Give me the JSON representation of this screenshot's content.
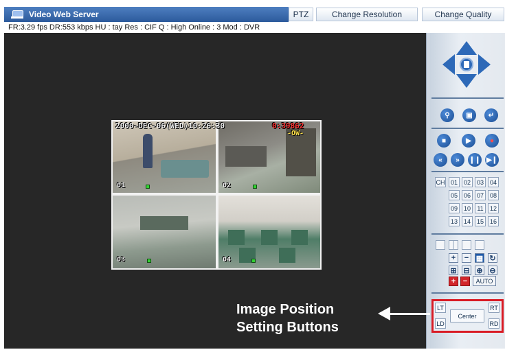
{
  "titlebar": {
    "title": "Video Web Server",
    "logo_icon": "monitor-icon"
  },
  "toolbar": {
    "ptz_label": "PTZ",
    "resolution_label": "Change Resolution",
    "quality_label": "Change Quality"
  },
  "status": {
    "text": "FR:3.29 fps  DR:553 kbps  HU : tay  Res : CIF  Q : High  Online : 3  Mod : DVR"
  },
  "video": {
    "date_overlay": "2000-DEC-06(WED)10:26:30",
    "rec_overlay": "0:39862",
    "sub_overlay": "-OW-",
    "channels": [
      "01",
      "02",
      "03",
      "04"
    ]
  },
  "controls": {
    "zoom_icons": [
      "zoom-in-icon",
      "search-icon",
      "return-icon"
    ],
    "playback_icons": [
      "stop-icon",
      "play-icon",
      "record-icon",
      "rewind-icon",
      "fast-forward-icon",
      "pause-icon",
      "step-icon"
    ],
    "channel_grid": {
      "ch_label": "CH",
      "rows": [
        [
          "01",
          "02",
          "03",
          "04"
        ],
        [
          "05",
          "06",
          "07",
          "08"
        ],
        [
          "09",
          "10",
          "11",
          "12"
        ],
        [
          "13",
          "14",
          "15",
          "16"
        ]
      ]
    },
    "auto_label": "AUTO"
  },
  "position": {
    "lt": "LT",
    "rt": "RT",
    "ld": "LD",
    "rd": "RD",
    "center": "Center"
  },
  "callout": {
    "line1": "Image Position",
    "line2": "Setting Buttons"
  },
  "colors": {
    "title_bar": "#2c5a9c",
    "viewer_bg": "#272727",
    "panel_blue": "#2d69b8",
    "highlight_red": "#d91b24"
  }
}
